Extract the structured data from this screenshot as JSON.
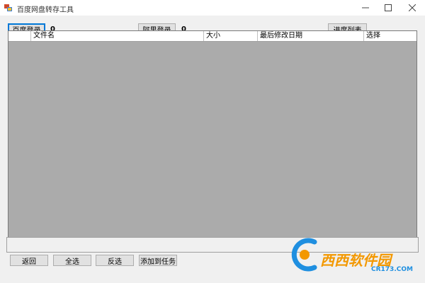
{
  "window": {
    "title": "百度网盘转存工具"
  },
  "toolbar": {
    "baidu_login_label": "百度登录",
    "baidu_count": "0",
    "aliyun_login_label": "阿里登录",
    "aliyun_count": "0",
    "progress_list_label": "进度列表"
  },
  "grid": {
    "columns": [
      "",
      "文件名",
      "大小",
      "最后修改日期",
      "选择"
    ]
  },
  "actions": {
    "back_label": "返回",
    "select_all_label": "全选",
    "invert_label": "反选",
    "add_task_label": "添加到任务"
  },
  "watermark": {
    "brand": "西西软件园",
    "site": "CR173.COM"
  },
  "colors": {
    "grid_background": "#ababab",
    "focus_border": "#0078d7",
    "watermark_blue": "#1f8fe0",
    "watermark_orange": "#f39800"
  }
}
